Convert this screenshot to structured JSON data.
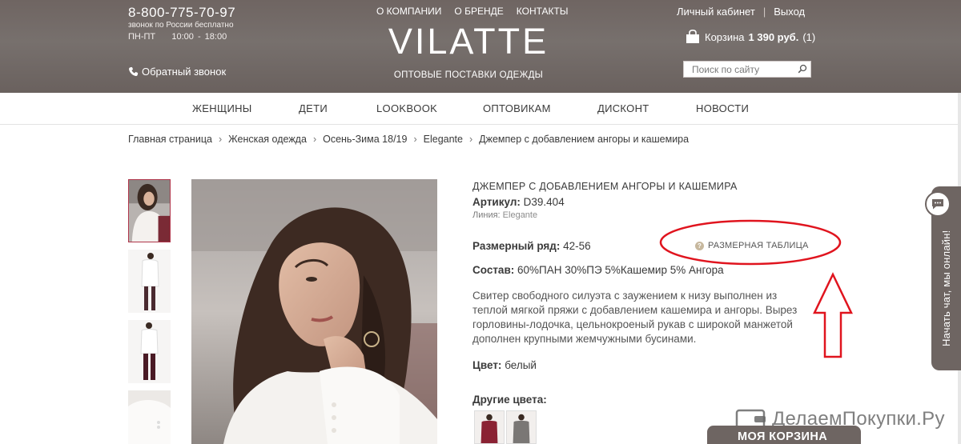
{
  "header": {
    "phone": "8-800-775-70-97",
    "phone_note": "звонок по России бесплатно",
    "hours": "ПН-ПТ    10:00 - 18:00",
    "callback": "Обратный звонок",
    "top_nav": [
      "О КОМПАНИИ",
      "О БРЕНДЕ",
      "КОНТАКТЫ"
    ],
    "logo": "VILATTE",
    "tagline": "ОПТОВЫЕ ПОСТАВКИ ОДЕЖДЫ",
    "account": "Личный кабинет",
    "separator": "|",
    "logout": "Выход",
    "cart_label": "Корзина",
    "cart_amount": "1 390 руб.",
    "cart_count": "(1)",
    "search_placeholder": "Поиск по сайту"
  },
  "main_nav": [
    "ЖЕНЩИНЫ",
    "ДЕТИ",
    "LOOKBOOK",
    "ОПТОВИКАМ",
    "ДИСКОНТ",
    "НОВОСТИ"
  ],
  "breadcrumb": {
    "items": [
      "Главная страница",
      "Женская одежда",
      "Осень-Зима 18/19",
      "Elegante",
      "Джемпер с добавлением ангоры и кашемира"
    ],
    "separator": "›"
  },
  "product": {
    "title": "ДЖЕМПЕР С ДОБАВЛЕНИЕМ АНГОРЫ И КАШЕМИРА",
    "article_label": "Артикул:",
    "article_value": "D39.404",
    "line_label": "Линия:",
    "line_value": "Elegante",
    "size_label": "Размерный ряд:",
    "size_value": "42-56",
    "size_table_link": "РАЗМЕРНАЯ ТАБЛИЦА",
    "size_table_icon": "?",
    "composition_label": "Состав:",
    "composition_value": "60%ПАН 30%ПЭ 5%Кашемир 5% Ангора",
    "description": "Свитер свободного силуэта с заужением к низу выполнен из теплой мягкой пряжи с добавлением кашемира и ангоры. Вырез горловины-лодочка, цельнокроеный рукав с широкой манжетой дополнен крупными жемчужными бусинами.",
    "color_label": "Цвет:",
    "color_value": "белый",
    "other_colors_label": "Другие цвета:"
  },
  "chat": {
    "text": "Начать чат, мы онлайн!"
  },
  "my_cart": "МОЯ КОРЗИНА",
  "watermark": "ДелаемПокупки.Ру",
  "colors": {
    "header_bg": "#6f6562",
    "annotation_red": "#e0141e",
    "active_thumb_border": "#b0354a"
  }
}
